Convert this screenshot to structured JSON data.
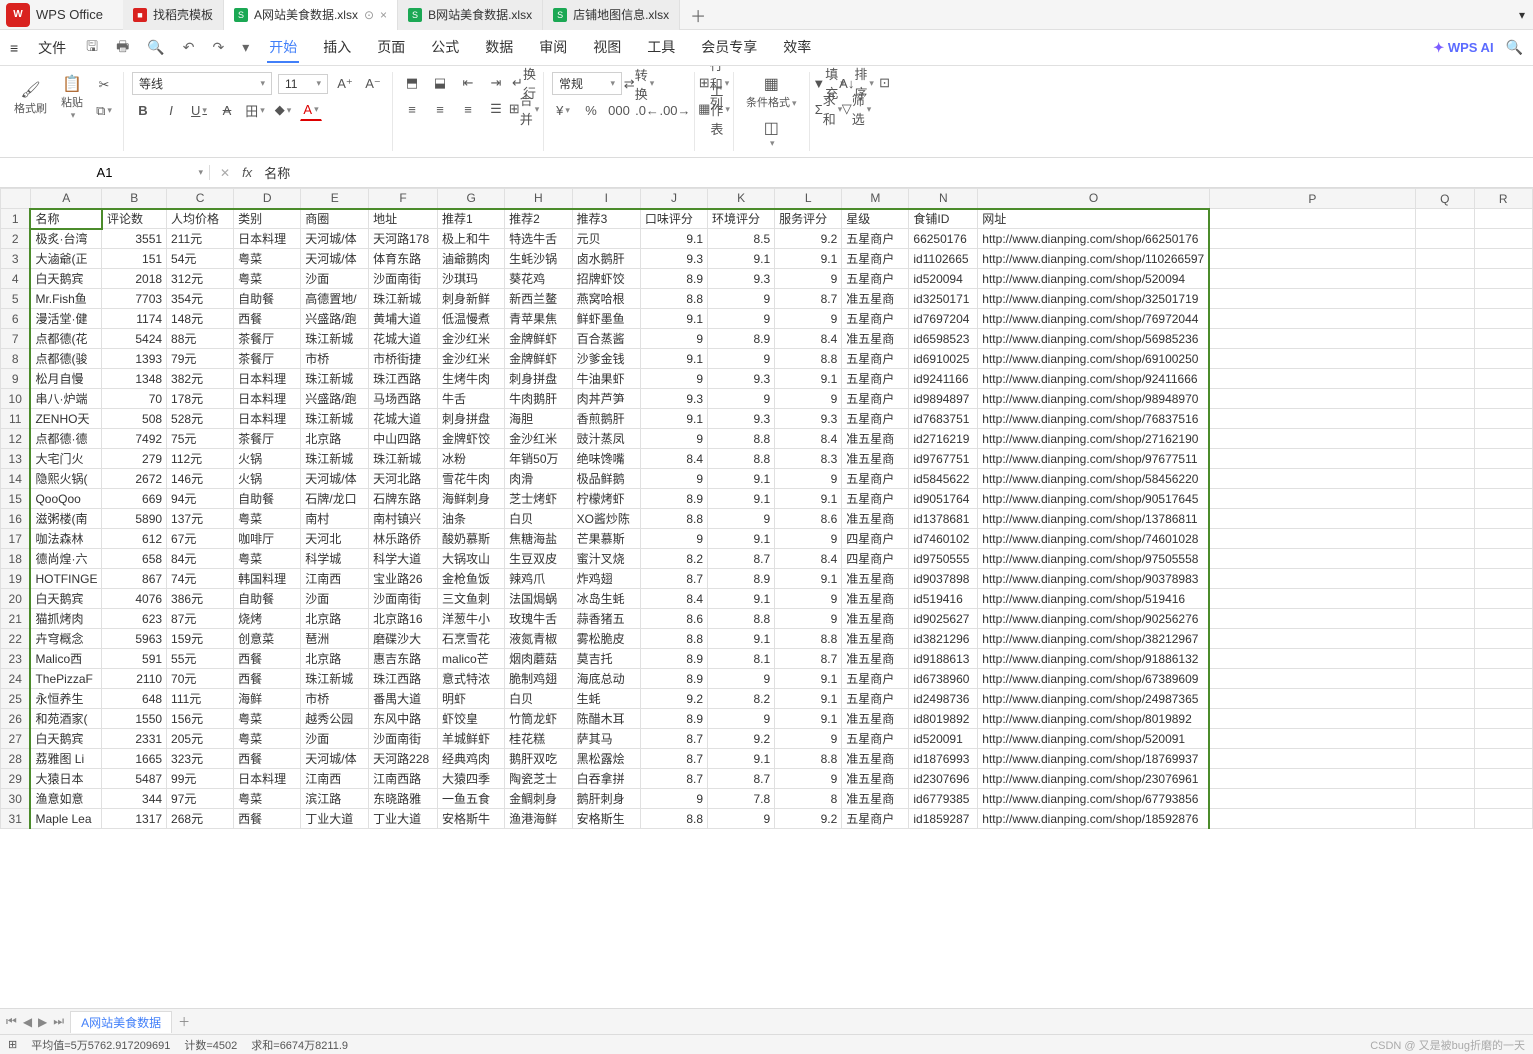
{
  "app": {
    "name": "WPS Office"
  },
  "tabs": [
    {
      "icon": "red",
      "label": "找稻壳模板"
    },
    {
      "icon": "green",
      "label": "A网站美食数据.xlsx",
      "active": true,
      "closable": true
    },
    {
      "icon": "green",
      "label": "B网站美食数据.xlsx"
    },
    {
      "icon": "green",
      "label": "店铺地图信息.xlsx"
    }
  ],
  "menu": {
    "file": "文件",
    "items": [
      "开始",
      "插入",
      "页面",
      "公式",
      "数据",
      "审阅",
      "视图",
      "工具",
      "会员专享",
      "效率"
    ],
    "active": "开始",
    "ai": "WPS AI"
  },
  "ribbon": {
    "fmt_brush": "格式刷",
    "paste": "粘贴",
    "font": "等线",
    "size": "11",
    "wrap": "换行",
    "merge": "合并",
    "num_fmt": "常规",
    "convert": "转换",
    "rows_cols": "行和列",
    "worksheet": "工作表",
    "cond_fmt": "条件格式",
    "fill": "填充",
    "sort": "排序",
    "sum": "求和",
    "filter": "筛选"
  },
  "addr": {
    "cell": "A1",
    "fx_value": "名称"
  },
  "columns": [
    "A",
    "B",
    "C",
    "D",
    "E",
    "F",
    "G",
    "H",
    "I",
    "J",
    "K",
    "L",
    "M",
    "N",
    "O",
    "P",
    "Q",
    "R"
  ],
  "headers": [
    "名称",
    "评论数",
    "人均价格",
    "类别",
    "商圈",
    "地址",
    "推荐1",
    "推荐2",
    "推荐3",
    "口味评分",
    "环境评分",
    "服务评分",
    "星级",
    "食铺ID",
    "网址"
  ],
  "rows": [
    [
      "极炙·台湾",
      "3551",
      "211元",
      "日本料理",
      "天河城/体",
      "天河路178",
      "极上和牛",
      "特选牛舌",
      "元贝",
      "9.1",
      "8.5",
      "9.2",
      "五星商户",
      "66250176",
      "http://www.dianping.com/shop/66250176"
    ],
    [
      "大滷爺(正",
      "151",
      "54元",
      "粤菜",
      "天河城/体",
      "体育东路",
      "滷爺鹅肉",
      "生蚝沙锅",
      "卤水鹅肝",
      "9.3",
      "9.1",
      "9.1",
      "五星商户",
      "id1102665",
      "http://www.dianping.com/shop/110266597"
    ],
    [
      "白天鹅宾",
      "2018",
      "312元",
      "粤菜",
      "沙面",
      "沙面南街",
      "沙琪玛",
      "葵花鸡",
      "招牌虾饺",
      "8.9",
      "9.3",
      "9",
      "五星商户",
      "id520094",
      "http://www.dianping.com/shop/520094"
    ],
    [
      "Mr.Fish鱼",
      "7703",
      "354元",
      "自助餐",
      "高德置地/",
      "珠江新城",
      "刺身新鲜",
      "新西兰鳌",
      "燕窝哈根",
      "8.8",
      "9",
      "8.7",
      "准五星商",
      "id3250171",
      "http://www.dianping.com/shop/32501719"
    ],
    [
      "漫活堂·健",
      "1174",
      "148元",
      "西餐",
      "兴盛路/跑",
      "黄埔大道",
      "低温慢煮",
      "青苹果焦",
      "鲜虾墨鱼",
      "9.1",
      "9",
      "9",
      "五星商户",
      "id7697204",
      "http://www.dianping.com/shop/76972044"
    ],
    [
      "点都德(花",
      "5424",
      "88元",
      "茶餐厅",
      "珠江新城",
      "花城大道",
      "金沙红米",
      "金牌鲜虾",
      "百合蒸酱",
      "9",
      "8.9",
      "8.4",
      "准五星商",
      "id6598523",
      "http://www.dianping.com/shop/56985236"
    ],
    [
      "点都德(骏",
      "1393",
      "79元",
      "茶餐厅",
      "市桥",
      "市桥街捷",
      "金沙红米",
      "金牌鲜虾",
      "沙爹金钱",
      "9.1",
      "9",
      "8.8",
      "五星商户",
      "id6910025",
      "http://www.dianping.com/shop/69100250"
    ],
    [
      "松月自慢",
      "1348",
      "382元",
      "日本料理",
      "珠江新城",
      "珠江西路",
      "生烤牛肉",
      "刺身拼盘",
      "牛油果虾",
      "9",
      "9.3",
      "9.1",
      "五星商户",
      "id9241166",
      "http://www.dianping.com/shop/92411666"
    ],
    [
      "串八·炉端",
      "70",
      "178元",
      "日本料理",
      "兴盛路/跑",
      "马场西路",
      "牛舌",
      "牛肉鹅肝",
      "肉丼芦笋",
      "9.3",
      "9",
      "9",
      "五星商户",
      "id9894897",
      "http://www.dianping.com/shop/98948970"
    ],
    [
      "ZENHO天",
      "508",
      "528元",
      "日本料理",
      "珠江新城",
      "花城大道",
      "刺身拼盘",
      "海胆",
      "香煎鹅肝",
      "9.1",
      "9.3",
      "9.3",
      "五星商户",
      "id7683751",
      "http://www.dianping.com/shop/76837516"
    ],
    [
      "点都德·德",
      "7492",
      "75元",
      "茶餐厅",
      "北京路",
      "中山四路",
      "金牌虾饺",
      "金沙红米",
      "豉汁蒸凤",
      "9",
      "8.8",
      "8.4",
      "准五星商",
      "id2716219",
      "http://www.dianping.com/shop/27162190"
    ],
    [
      "大宅门火",
      "279",
      "112元",
      "火锅",
      "珠江新城",
      "珠江新城",
      "冰粉",
      "年销50万",
      "绝味馋嘴",
      "8.4",
      "8.8",
      "8.3",
      "准五星商",
      "id9767751",
      "http://www.dianping.com/shop/97677511"
    ],
    [
      "隐熙火锅(",
      "2672",
      "146元",
      "火锅",
      "天河城/体",
      "天河北路",
      "雪花牛肉",
      "肉滑",
      "极品鲜鹅",
      "9",
      "9.1",
      "9",
      "五星商户",
      "id5845622",
      "http://www.dianping.com/shop/58456220"
    ],
    [
      "QooQoo",
      "669",
      "94元",
      "自助餐",
      "石牌/龙口",
      "石牌东路",
      "海鲜刺身",
      "芝士烤虾",
      "柠檬烤虾",
      "8.9",
      "9.1",
      "9.1",
      "五星商户",
      "id9051764",
      "http://www.dianping.com/shop/90517645"
    ],
    [
      "滋粥楼(南",
      "5890",
      "137元",
      "粤菜",
      "南村",
      "南村镇兴",
      "油条",
      "白贝",
      "XO酱炒陈",
      "8.8",
      "9",
      "8.6",
      "准五星商",
      "id1378681",
      "http://www.dianping.com/shop/13786811"
    ],
    [
      "咖法森林",
      "612",
      "67元",
      "咖啡厅",
      "天河北",
      "林乐路侨",
      "酸奶慕斯",
      "焦糖海盐",
      "芒果慕斯",
      "9",
      "9.1",
      "9",
      "四星商户",
      "id7460102",
      "http://www.dianping.com/shop/74601028"
    ],
    [
      "德尚煌·六",
      "658",
      "84元",
      "粤菜",
      "科学城",
      "科学大道",
      "大锅攻山",
      "生豆双皮",
      "蜜汁叉烧",
      "8.2",
      "8.7",
      "8.4",
      "四星商户",
      "id9750555",
      "http://www.dianping.com/shop/97505558"
    ],
    [
      "HOTFINGE",
      "867",
      "74元",
      "韩国料理",
      "江南西",
      "宝业路26",
      "金枪鱼饭",
      "辣鸡爪",
      "炸鸡翅",
      "8.7",
      "8.9",
      "9.1",
      "准五星商",
      "id9037898",
      "http://www.dianping.com/shop/90378983"
    ],
    [
      "白天鹅宾",
      "4076",
      "386元",
      "自助餐",
      "沙面",
      "沙面南街",
      "三文鱼刺",
      "法国焗蜗",
      "冰岛生蚝",
      "8.4",
      "9.1",
      "9",
      "准五星商",
      "id519416",
      "http://www.dianping.com/shop/519416"
    ],
    [
      "猫抓烤肉",
      "623",
      "87元",
      "烧烤",
      "北京路",
      "北京路16",
      "洋葱牛小",
      "玫瑰牛舌",
      "蒜香猪五",
      "8.6",
      "8.8",
      "9",
      "准五星商",
      "id9025627",
      "http://www.dianping.com/shop/90256276"
    ],
    [
      "卉穹概念",
      "5963",
      "159元",
      "创意菜",
      "琶洲",
      "磨碟沙大",
      "石烹雪花",
      "液氮青椒",
      "雾松脆皮",
      "8.8",
      "9.1",
      "8.8",
      "准五星商",
      "id3821296",
      "http://www.dianping.com/shop/38212967"
    ],
    [
      "Malico西",
      "591",
      "55元",
      "西餐",
      "北京路",
      "惠吉东路",
      "malico芒",
      "烟肉蘑菇",
      "莫吉托",
      "8.9",
      "8.1",
      "8.7",
      "准五星商",
      "id9188613",
      "http://www.dianping.com/shop/91886132"
    ],
    [
      "ThePizzaF",
      "2110",
      "70元",
      "西餐",
      "珠江新城",
      "珠江西路",
      "意式特浓",
      "脆制鸡翅",
      "海底总动",
      "8.9",
      "9",
      "9.1",
      "五星商户",
      "id6738960",
      "http://www.dianping.com/shop/67389609"
    ],
    [
      "永恒养生",
      "648",
      "111元",
      "海鲜",
      "市桥",
      "番禺大道",
      "明虾",
      "白贝",
      "生蚝",
      "9.2",
      "8.2",
      "9.1",
      "五星商户",
      "id2498736",
      "http://www.dianping.com/shop/24987365"
    ],
    [
      "和苑酒家(",
      "1550",
      "156元",
      "粤菜",
      "越秀公园",
      "东风中路",
      "虾饺皇",
      "竹筒龙虾",
      "陈醋木耳",
      "8.9",
      "9",
      "9.1",
      "准五星商",
      "id8019892",
      "http://www.dianping.com/shop/8019892"
    ],
    [
      "白天鹅宾",
      "2331",
      "205元",
      "粤菜",
      "沙面",
      "沙面南街",
      "羊城鲜虾",
      "桂花糕",
      "萨其马",
      "8.7",
      "9.2",
      "9",
      "五星商户",
      "id520091",
      "http://www.dianping.com/shop/520091"
    ],
    [
      "荔雅图 Li",
      "1665",
      "323元",
      "西餐",
      "天河城/体",
      "天河路228",
      "经典鸡肉",
      "鹅肝双吃",
      "黑松露烩",
      "8.7",
      "9.1",
      "8.8",
      "准五星商",
      "id1876993",
      "http://www.dianping.com/shop/18769937"
    ],
    [
      "大猿日本",
      "5487",
      "99元",
      "日本料理",
      "江南西",
      "江南西路",
      "大猿四季",
      "陶瓷芝士",
      "白吞拿拼",
      "8.7",
      "8.7",
      "9",
      "准五星商",
      "id2307696",
      "http://www.dianping.com/shop/23076961"
    ],
    [
      "渔意如意",
      "344",
      "97元",
      "粤菜",
      "滨江路",
      "东晓路雅",
      "一鱼五食",
      "金鲷刺身",
      "鹅肝刺身",
      "9",
      "7.8",
      "8",
      "准五星商",
      "id6779385",
      "http://www.dianping.com/shop/67793856"
    ],
    [
      "Maple Lea",
      "1317",
      "268元",
      "西餐",
      "丁业大道",
      "丁业大道",
      "安格斯牛",
      "渔港海鲜",
      "安格斯生",
      "8.8",
      "9",
      "9.2",
      "五星商户",
      "id1859287",
      "http://www.dianping.com/shop/18592876"
    ]
  ],
  "sheet": {
    "name": "A网站美食数据"
  },
  "status": {
    "avg": "平均值=5万5762.917209691",
    "count": "计数=4502",
    "sum": "求和=6674万8211.9",
    "watermark": "CSDN @ 又是被bug折磨的一天"
  }
}
